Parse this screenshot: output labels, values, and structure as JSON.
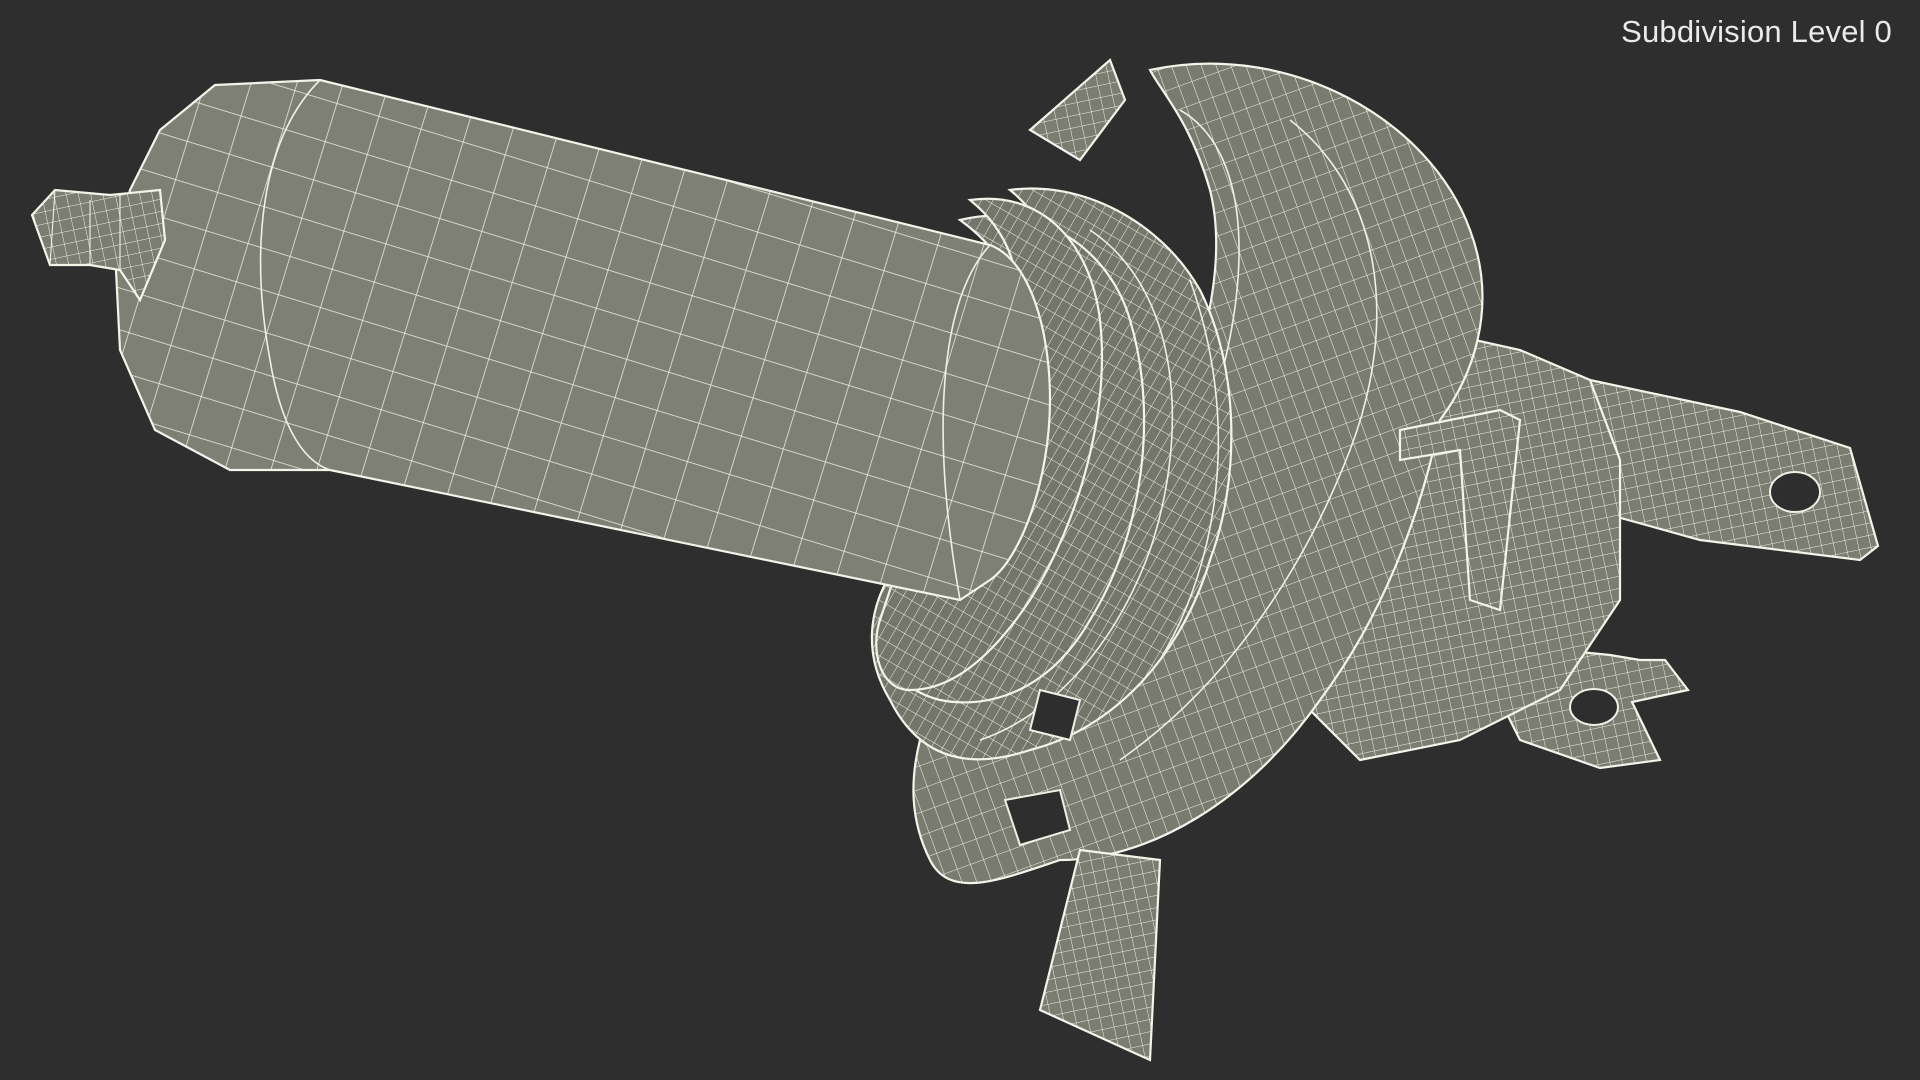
{
  "viewport": {
    "label": "Subdivision Level 0",
    "background_color": "#2e2e2e",
    "wire_color": "#f0efe6",
    "surface_color": "#7e7f74"
  },
  "model": {
    "depiction": "wireframe-headlight-bulb-mesh"
  }
}
